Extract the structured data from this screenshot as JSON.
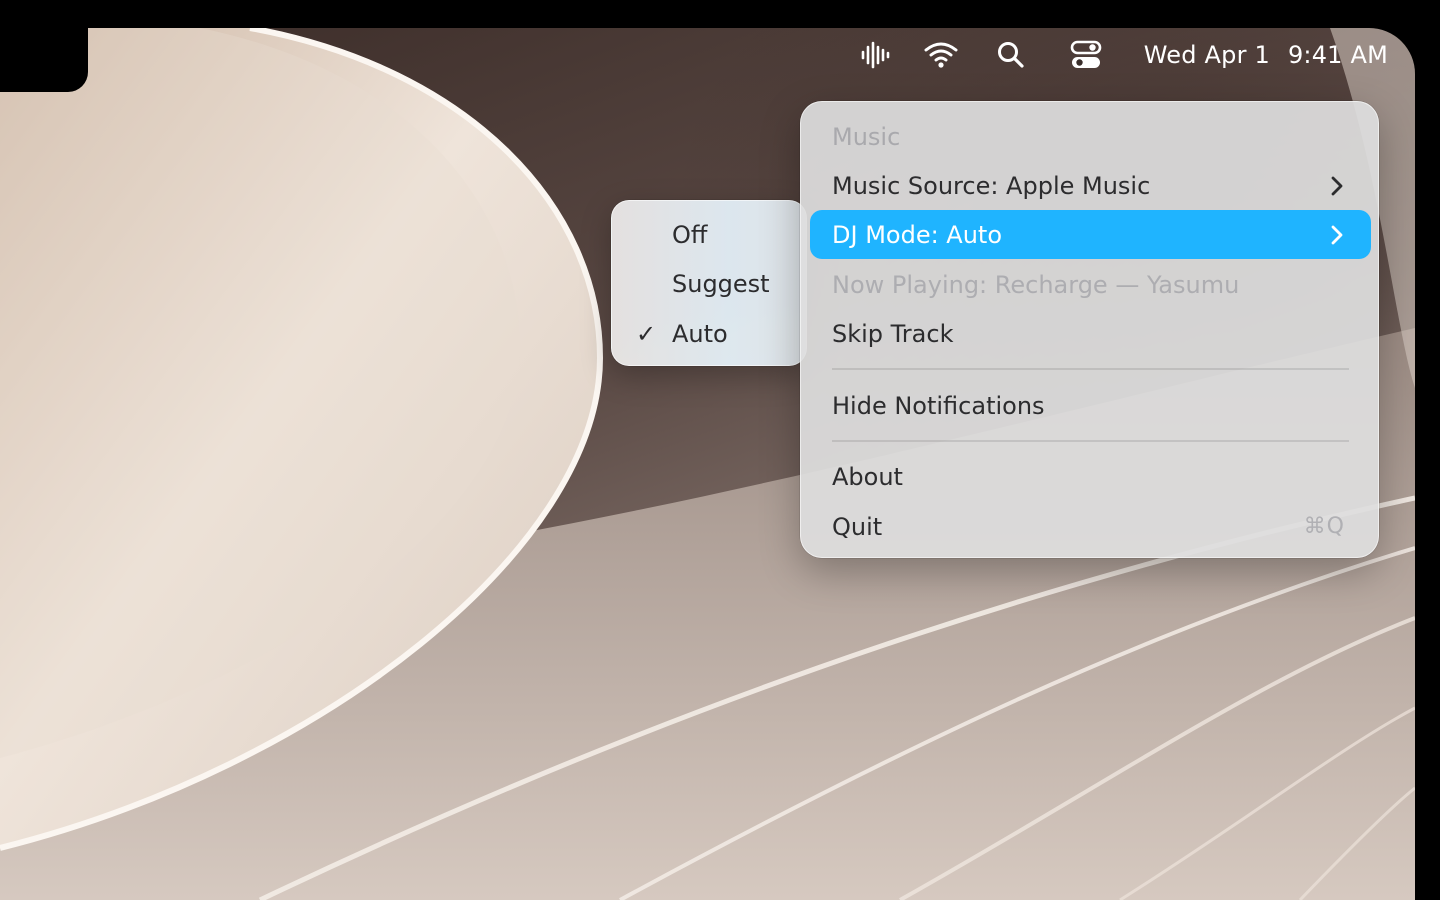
{
  "menubar": {
    "icons": [
      "audio-waveform-icon",
      "wifi-icon",
      "search-icon",
      "control-center-icon"
    ],
    "date": "Wed Apr 1",
    "time": "9:41 AM"
  },
  "menu": {
    "header": "Music",
    "items": [
      {
        "label": "Music Source: Apple Music",
        "submenu": true
      },
      {
        "label": "DJ Mode: Auto",
        "submenu": true,
        "highlighted": true
      },
      {
        "label": "Now Playing: Recharge — Yasumu",
        "disabled": true
      },
      {
        "label": "Skip Track"
      },
      {
        "label": "Hide Notifications"
      },
      {
        "label": "About"
      },
      {
        "label": "Quit",
        "shortcut": "⌘Q"
      }
    ]
  },
  "submenu": {
    "items": [
      {
        "label": "Off",
        "checked": false
      },
      {
        "label": "Suggest",
        "checked": false
      },
      {
        "label": "Auto",
        "checked": true
      }
    ],
    "check_glyph": "✓"
  },
  "colors": {
    "highlight": "#1fb4ff",
    "menu_text": "#2c2c2e",
    "disabled_text": "#adadb1"
  }
}
